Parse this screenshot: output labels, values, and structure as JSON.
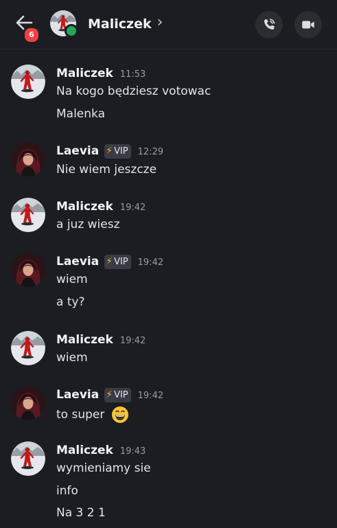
{
  "header": {
    "unread_count": "6",
    "title": "Maliczek",
    "chevron": "›",
    "icons": {
      "back": "arrow-left-icon",
      "call": "phone-icon",
      "video": "video-camera-icon"
    },
    "status_color": "#23a55a"
  },
  "colors": {
    "background": "#1c1d22",
    "badge": "#f23f43",
    "vip_bolt": "#f0b232"
  },
  "messages": [
    {
      "author": "Maliczek",
      "time": "11:53",
      "vip": false,
      "lines": [
        "Na kogo będziesz votowac",
        "Malenka"
      ]
    },
    {
      "author": "Laevia",
      "time": "12:29",
      "vip": true,
      "vip_label": "VIP",
      "lines": [
        "Nie wiem jeszcze"
      ]
    },
    {
      "author": "Maliczek",
      "time": "19:42",
      "vip": false,
      "lines": [
        "a juz wiesz"
      ]
    },
    {
      "author": "Laevia",
      "time": "19:42",
      "vip": true,
      "vip_label": "VIP",
      "lines": [
        "wiem",
        "a ty?"
      ]
    },
    {
      "author": "Maliczek",
      "time": "19:42",
      "vip": false,
      "lines": [
        "wiem"
      ]
    },
    {
      "author": "Laevia",
      "time": "19:42",
      "vip": true,
      "vip_label": "VIP",
      "lines": [
        "to super"
      ],
      "emoji": "grinning-face-emoji"
    },
    {
      "author": "Maliczek",
      "time": "19:43",
      "vip": false,
      "lines": [
        "wymieniamy sie",
        "info",
        "Na 3 2 1"
      ]
    }
  ]
}
